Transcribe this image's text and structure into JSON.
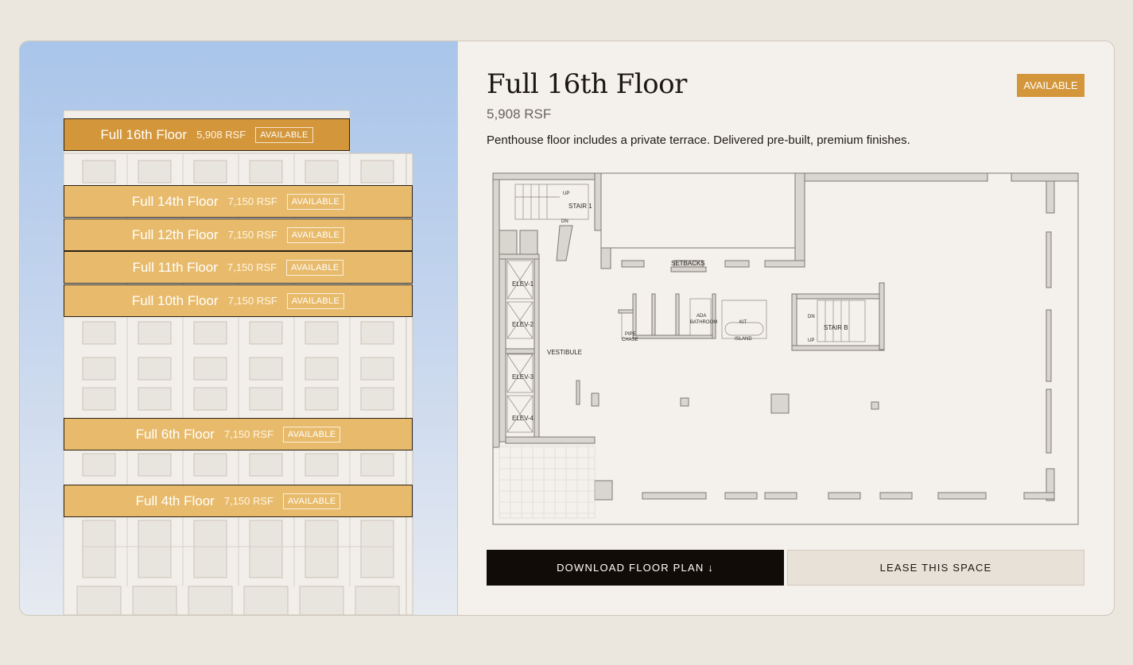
{
  "floors": [
    {
      "name": "Full 16th Floor",
      "rsf": "5,908 RSF",
      "status": "AVAILABLE"
    },
    {
      "name": "Full 14th Floor",
      "rsf": "7,150 RSF",
      "status": "AVAILABLE"
    },
    {
      "name": "Full 12th Floor",
      "rsf": "7,150 RSF",
      "status": "AVAILABLE"
    },
    {
      "name": "Full 11th Floor",
      "rsf": "7,150 RSF",
      "status": "AVAILABLE"
    },
    {
      "name": "Full 10th Floor",
      "rsf": "7,150 RSF",
      "status": "AVAILABLE"
    },
    {
      "name": "Full 6th Floor",
      "rsf": "7,150 RSF",
      "status": "AVAILABLE"
    },
    {
      "name": "Full 4th Floor",
      "rsf": "7,150 RSF",
      "status": "AVAILABLE"
    }
  ],
  "detail": {
    "title": "Full 16th Floor",
    "rsf": "5,908 RSF",
    "status": "AVAILABLE",
    "description": "Penthouse floor includes a private terrace. Delivered pre-built, premium finishes."
  },
  "plan_labels": {
    "up": "UP",
    "dn": "DN",
    "stair1": "STAIR 1",
    "setbacks": "SETBACKS",
    "elev1": "ELEV-1",
    "elev2": "ELEV-2",
    "elev3": "ELEV-3",
    "elev4": "ELEV-4",
    "vestibule": "VESTIBULE",
    "ada": "ADA",
    "bathroom": "BATHROOM",
    "kit": "KIT",
    "island": "ISLAND",
    "pipe": "PIPE",
    "chase": "CHASE",
    "stairb": "STAIR B"
  },
  "actions": {
    "download": "DOWNLOAD FLOOR PLAN ↓",
    "lease": "LEASE THIS SPACE"
  },
  "colors": {
    "accent": "#d3963a",
    "band": "#e8bb6c",
    "dark": "#120c08"
  }
}
